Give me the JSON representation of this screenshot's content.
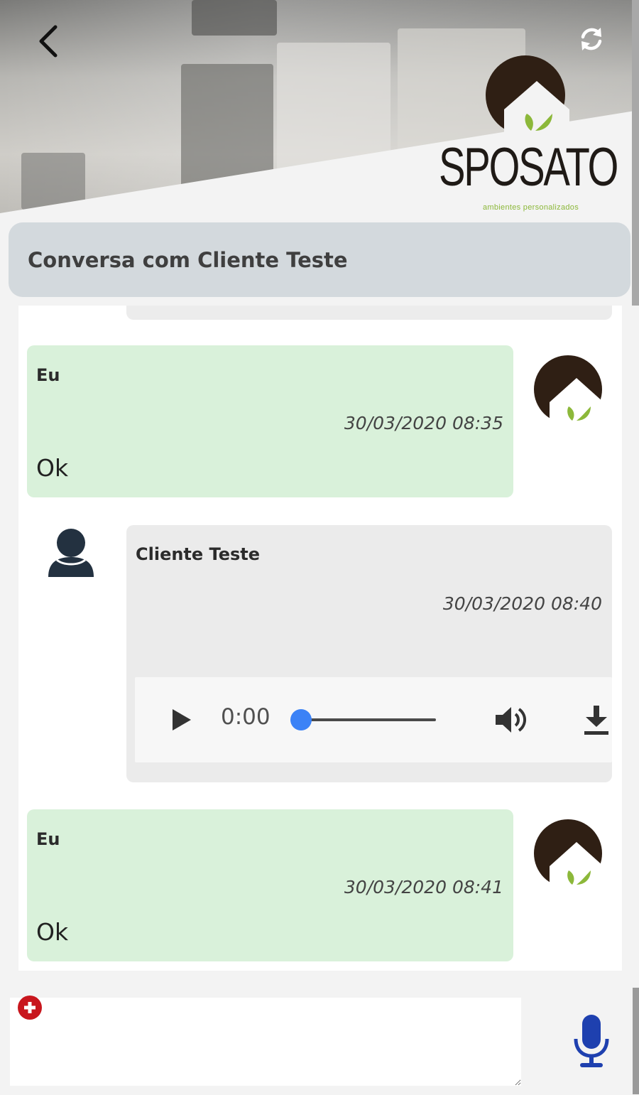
{
  "header": {
    "back_icon": "chevron-left-icon",
    "refresh_icon": "refresh-icon",
    "logo": {
      "wordmark": "SPOSATO",
      "tagline": "ambientes personalizados"
    }
  },
  "conversation": {
    "title": "Conversa com Cliente Teste"
  },
  "messages": [
    {
      "author": "Eu",
      "time": "30/03/2020 08:35",
      "text": "Ok",
      "side": "right"
    },
    {
      "author": "Cliente Teste",
      "time": "30/03/2020 08:40",
      "side": "left",
      "audio": {
        "current_time": "0:00",
        "progress": 0
      }
    },
    {
      "author": "Eu",
      "time": "30/03/2020 08:41",
      "text": "Ok",
      "side": "right"
    }
  ],
  "composer": {
    "placeholder": "",
    "attach_icon": "plus-circle-icon",
    "mic_icon": "microphone-icon"
  },
  "colors": {
    "my_bubble": "#d9f1da",
    "other_bubble": "#ebebeb",
    "title_bar": "#d3d9dd",
    "audio_knob": "#3b82f6",
    "mic": "#1e40af",
    "attach": "#c8161d",
    "logo_brown": "#2f1f14",
    "logo_green": "#8cb83a"
  }
}
